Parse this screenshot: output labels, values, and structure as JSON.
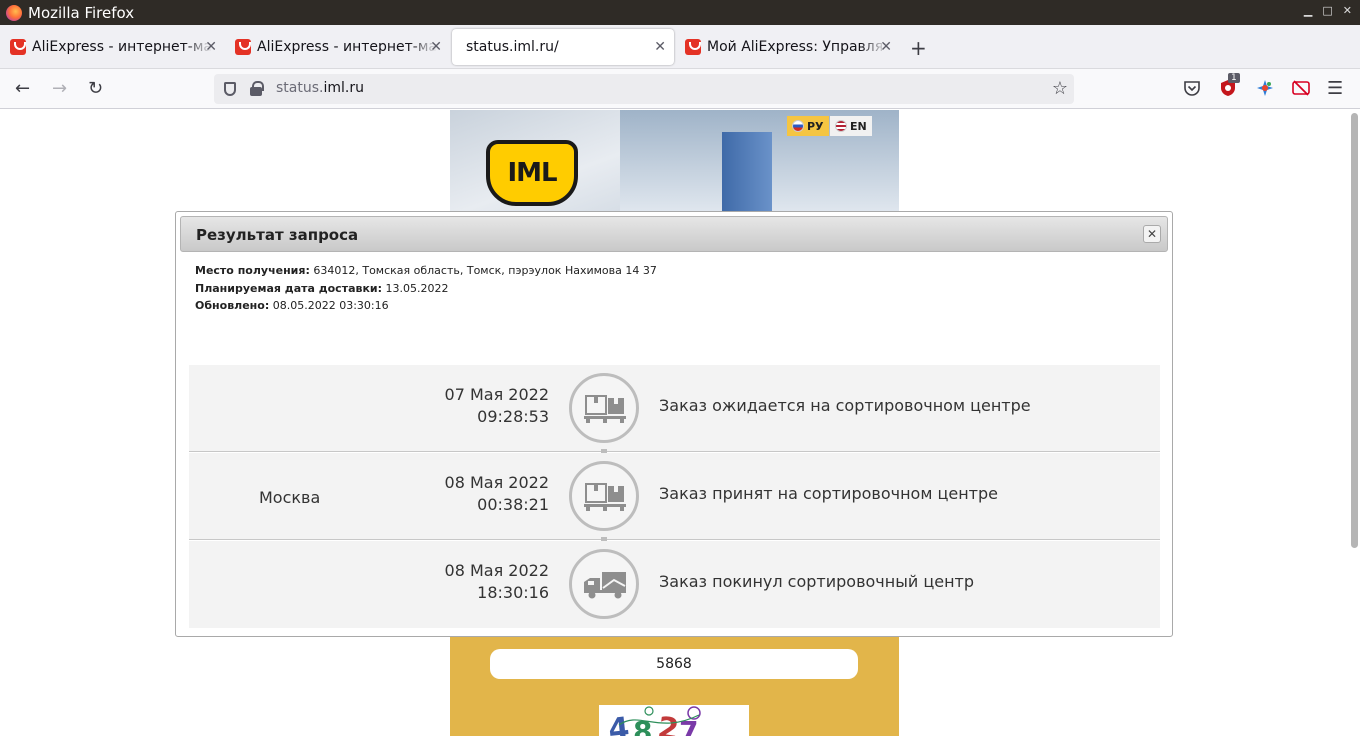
{
  "window": {
    "title": "Mozilla Firefox",
    "controls": [
      "▁",
      "□",
      "✕"
    ]
  },
  "tabs": [
    {
      "label": "AliExpress - интернет-магазин",
      "icon": "aliexpress-icon"
    },
    {
      "label": "AliExpress - интернет-магазин",
      "icon": "aliexpress-icon"
    },
    {
      "label": "status.iml.ru/",
      "icon": "none"
    },
    {
      "label": "Мой AliExpress: Управлять заказами",
      "icon": "aliexpress-icon"
    }
  ],
  "tab_close_glyph": "✕",
  "new_tab_glyph": "+",
  "nav": {
    "back_glyph": "←",
    "forward_glyph": "→",
    "reload_glyph": "↻",
    "url_prefix": "status.",
    "url_domain": "iml.ru",
    "star_glyph": "☆",
    "menu_glyph": "☰",
    "ublock_badge": "1"
  },
  "banner": {
    "logo_text": "IML",
    "lang_ru": "РУ",
    "lang_en": "EN"
  },
  "dialog": {
    "title": "Результат запроса",
    "close_glyph": "✕",
    "place_label": "Место получения:",
    "place_value": "634012, Томская область, Томск, пэрэулок Нахимова 14 37",
    "planned_label": "Планируемая дата доставки:",
    "planned_value": "13.05.2022",
    "updated_label": "Обновлено:",
    "updated_value": "08.05.2022 03:30:16"
  },
  "tracking": [
    {
      "city": "",
      "date": "07 Мая 2022",
      "time": "09:28:53",
      "status": "Заказ ожидается на сортировочном центре",
      "icon": "warehouse-icon"
    },
    {
      "city": "Москва",
      "date": "08 Мая 2022",
      "time": "00:38:21",
      "status": "Заказ принят на сортировочном центре",
      "icon": "warehouse-icon"
    },
    {
      "city": "",
      "date": "08 Мая 2022",
      "time": "18:30:16",
      "status": "Заказ покинул сортировочный центр",
      "icon": "truck-icon"
    }
  ],
  "form": {
    "code_value": "5868"
  },
  "colors": {
    "accent_yellow": "#e2b54a",
    "logo_yellow": "#ffcc00",
    "firefox_titlebar": "#2f2b26"
  }
}
